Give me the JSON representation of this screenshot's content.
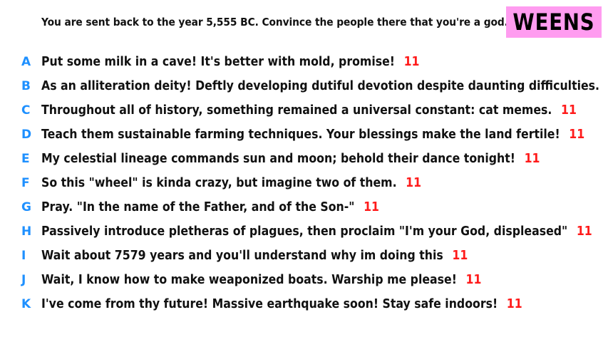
{
  "prompt": "You are sent back to the year 5,555 BC. Convince the people there that you're a god.",
  "brand": "WEENS",
  "colors": {
    "brand_bg": "#ff9cf0",
    "letter": "#1e90ff",
    "score": "#ff1a1a"
  },
  "answers": [
    {
      "letter": "A",
      "text": "Put some milk in a cave! It's better with mold, promise!",
      "score": "11"
    },
    {
      "letter": "B",
      "text": "As an alliteration deity! Deftly developing dutiful devotion despite daunting difficulties.",
      "score": "11"
    },
    {
      "letter": "C",
      "text": "Throughout all of history, something remained a universal constant: cat memes.",
      "score": "11"
    },
    {
      "letter": "D",
      "text": "Teach them sustainable farming techniques. Your blessings make the land fertile!",
      "score": "11"
    },
    {
      "letter": "E",
      "text": "My celestial lineage commands sun and moon; behold their dance tonight!",
      "score": "11"
    },
    {
      "letter": "F",
      "text": "So this \"wheel\" is kinda crazy, but imagine two of them.",
      "score": "11"
    },
    {
      "letter": "G",
      "text": "Pray. \"In the name of the Father, and of the Son-\"",
      "score": "11"
    },
    {
      "letter": "H",
      "text": "Passively introduce pletheras of plagues, then proclaim \"I'm your God, displeased\"",
      "score": "11"
    },
    {
      "letter": "I",
      "text": "Wait about 7579 years and you'll understand why im doing this",
      "score": "11"
    },
    {
      "letter": "J",
      "text": "Wait, I know how to make weaponized boats. Warship me please!",
      "score": "11"
    },
    {
      "letter": "K",
      "text": "I've come from thy future! Massive earthquake soon! Stay safe indoors!",
      "score": "11"
    }
  ]
}
